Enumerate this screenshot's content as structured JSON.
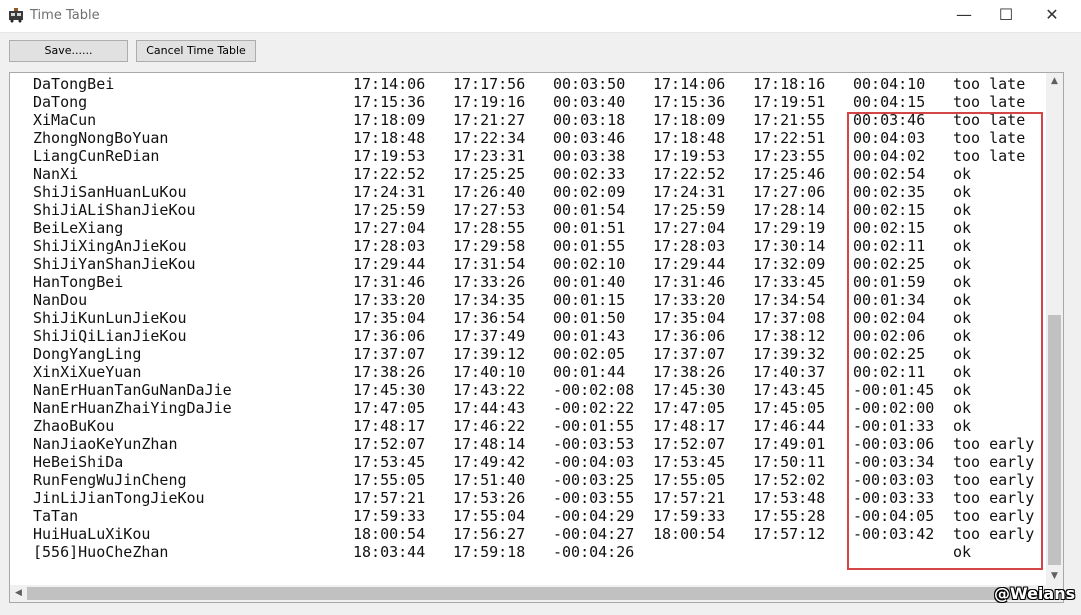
{
  "window": {
    "title": "Time Table",
    "minimize_glyph": "—",
    "maximize_glyph": "☐",
    "close_glyph": "✕"
  },
  "toolbar": {
    "save_label": "Save......",
    "cancel_label": "Cancel Time Table"
  },
  "rows": [
    [
      "DaTongBei",
      "17:14:06",
      "17:17:56",
      "00:03:50",
      "17:14:06",
      "17:18:16",
      "00:04:10",
      "too late"
    ],
    [
      "DaTong",
      "17:15:36",
      "17:19:16",
      "00:03:40",
      "17:15:36",
      "17:19:51",
      "00:04:15",
      "too late"
    ],
    [
      "XiMaCun",
      "17:18:09",
      "17:21:27",
      "00:03:18",
      "17:18:09",
      "17:21:55",
      "00:03:46",
      "too late"
    ],
    [
      "ZhongNongBoYuan",
      "17:18:48",
      "17:22:34",
      "00:03:46",
      "17:18:48",
      "17:22:51",
      "00:04:03",
      "too late"
    ],
    [
      "LiangCunReDian",
      "17:19:53",
      "17:23:31",
      "00:03:38",
      "17:19:53",
      "17:23:55",
      "00:04:02",
      "too late"
    ],
    [
      "NanXi",
      "17:22:52",
      "17:25:25",
      "00:02:33",
      "17:22:52",
      "17:25:46",
      "00:02:54",
      "ok"
    ],
    [
      "ShiJiSanHuanLuKou",
      "17:24:31",
      "17:26:40",
      "00:02:09",
      "17:24:31",
      "17:27:06",
      "00:02:35",
      "ok"
    ],
    [
      "ShiJiALiShanJieKou",
      "17:25:59",
      "17:27:53",
      "00:01:54",
      "17:25:59",
      "17:28:14",
      "00:02:15",
      "ok"
    ],
    [
      "BeiLeXiang",
      "17:27:04",
      "17:28:55",
      "00:01:51",
      "17:27:04",
      "17:29:19",
      "00:02:15",
      "ok"
    ],
    [
      "ShiJiXingAnJieKou",
      "17:28:03",
      "17:29:58",
      "00:01:55",
      "17:28:03",
      "17:30:14",
      "00:02:11",
      "ok"
    ],
    [
      "ShiJiYanShanJieKou",
      "17:29:44",
      "17:31:54",
      "00:02:10",
      "17:29:44",
      "17:32:09",
      "00:02:25",
      "ok"
    ],
    [
      "HanTongBei",
      "17:31:46",
      "17:33:26",
      "00:01:40",
      "17:31:46",
      "17:33:45",
      "00:01:59",
      "ok"
    ],
    [
      "NanDou",
      "17:33:20",
      "17:34:35",
      "00:01:15",
      "17:33:20",
      "17:34:54",
      "00:01:34",
      "ok"
    ],
    [
      "ShiJiKunLunJieKou",
      "17:35:04",
      "17:36:54",
      "00:01:50",
      "17:35:04",
      "17:37:08",
      "00:02:04",
      "ok"
    ],
    [
      "ShiJiQiLianJieKou",
      "17:36:06",
      "17:37:49",
      "00:01:43",
      "17:36:06",
      "17:38:12",
      "00:02:06",
      "ok"
    ],
    [
      "DongYangLing",
      "17:37:07",
      "17:39:12",
      "00:02:05",
      "17:37:07",
      "17:39:32",
      "00:02:25",
      "ok"
    ],
    [
      "XinXiXueYuan",
      "17:38:26",
      "17:40:10",
      "00:01:44",
      "17:38:26",
      "17:40:37",
      "00:02:11",
      "ok"
    ],
    [
      "NanErHuanTanGuNanDaJie",
      "17:45:30",
      "17:43:22",
      "-00:02:08",
      "17:45:30",
      "17:43:45",
      "-00:01:45",
      "ok"
    ],
    [
      "NanErHuanZhaiYingDaJie",
      "17:47:05",
      "17:44:43",
      "-00:02:22",
      "17:47:05",
      "17:45:05",
      "-00:02:00",
      "ok"
    ],
    [
      "ZhaoBuKou",
      "17:48:17",
      "17:46:22",
      "-00:01:55",
      "17:48:17",
      "17:46:44",
      "-00:01:33",
      "ok"
    ],
    [
      "NanJiaoKeYunZhan",
      "17:52:07",
      "17:48:14",
      "-00:03:53",
      "17:52:07",
      "17:49:01",
      "-00:03:06",
      "too early"
    ],
    [
      "HeBeiShiDa",
      "17:53:45",
      "17:49:42",
      "-00:04:03",
      "17:53:45",
      "17:50:11",
      "-00:03:34",
      "too early"
    ],
    [
      "RunFengWuJinCheng",
      "17:55:05",
      "17:51:40",
      "-00:03:25",
      "17:55:05",
      "17:52:02",
      "-00:03:03",
      "too early"
    ],
    [
      "JinLiJianTongJieKou",
      "17:57:21",
      "17:53:26",
      "-00:03:55",
      "17:57:21",
      "17:53:48",
      "-00:03:33",
      "too early"
    ],
    [
      "TaTan",
      "17:59:33",
      "17:55:04",
      "-00:04:29",
      "17:59:33",
      "17:55:28",
      "-00:04:05",
      "too early"
    ],
    [
      "HuiHuaLuXiKou",
      "18:00:54",
      "17:56:27",
      "-00:04:27",
      "18:00:54",
      "17:57:12",
      "-00:03:42",
      "too early"
    ],
    [
      "[556]HuoCheZhan",
      "18:03:44",
      "17:59:18",
      "-00:04:26",
      "",
      "",
      "",
      "ok"
    ]
  ],
  "watermark": "@Weians",
  "colors": {
    "highlight_border": "#d64545"
  }
}
